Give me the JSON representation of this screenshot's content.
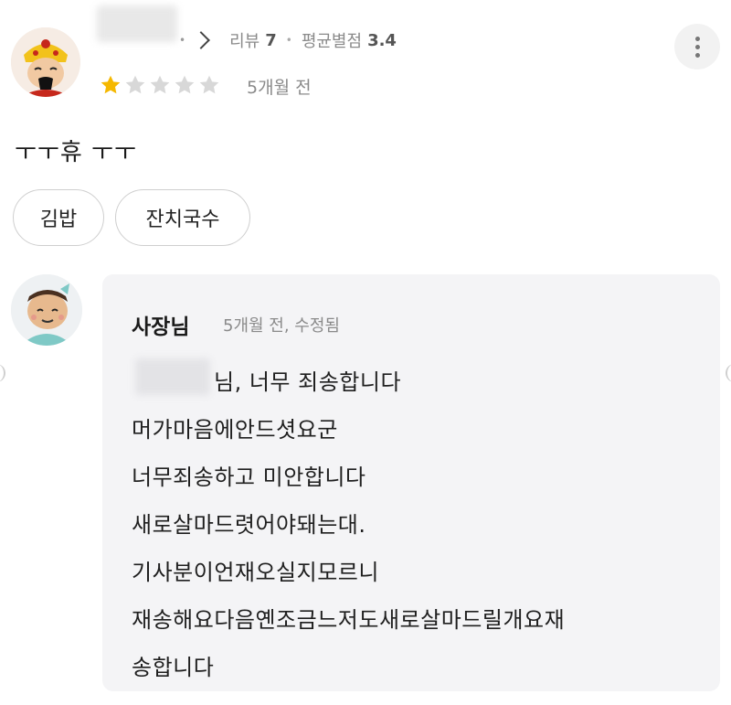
{
  "review": {
    "meta": {
      "reviews_label": "리뷰",
      "reviews_count": "7",
      "avg_label": "평균별점",
      "avg_value": "3.4"
    },
    "rating": 1,
    "max_rating": 5,
    "date": "5개월 전",
    "text": "ㅜㅜ휴 ㅜㅜ",
    "tags": [
      "김밥",
      "잔치국수"
    ],
    "icons": {
      "more": "more-vertical-icon",
      "chevron": "chevron-right-icon",
      "star": "star-icon"
    },
    "colors": {
      "star_filled": "#f5b800",
      "star_empty": "#d8d8d8"
    }
  },
  "owner_reply": {
    "name": "사장님",
    "meta": "5개월 전, 수정됨",
    "lines": [
      "님, 너무 죄송합니다",
      "머가마음에안드셧요군",
      "너무죄송하고 미안합니다",
      "새로살마드렷어야돼는대.",
      "기사분이언재오실지모르니",
      "재송해요다음옌조금느저도새로살마드릴개요재",
      "송합니다"
    ],
    "colors": {
      "bubble_bg": "#f4f4f6"
    }
  }
}
